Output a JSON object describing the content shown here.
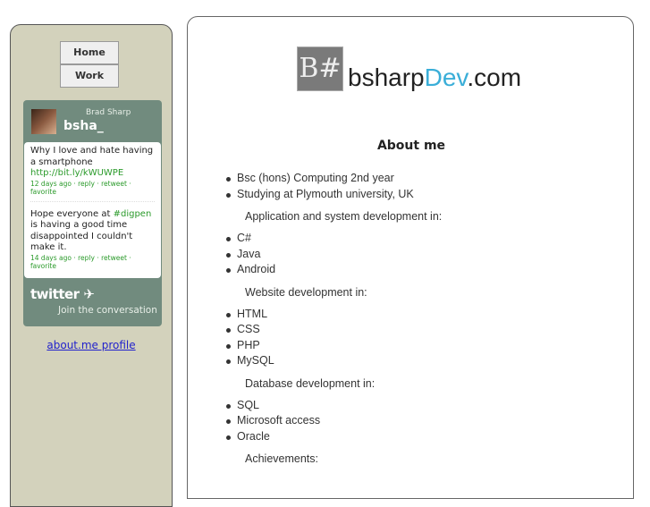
{
  "nav": {
    "home": "Home",
    "work": "Work"
  },
  "twitter": {
    "display_name": "Brad Sharp",
    "username": "bsha_",
    "tweets": [
      {
        "text": "Why I love and hate having a smartphone ",
        "link": "http://bit.ly/kWUWPE",
        "time": "12 days ago",
        "reply": "reply",
        "retweet": "retweet",
        "favorite": "favorite"
      },
      {
        "text_before": "Hope everyone at ",
        "hashtag": "#digpen",
        "text_after": " is having a good time disappointed I couldn't make it.",
        "time": "14 days ago",
        "reply": "reply",
        "retweet": "retweet",
        "favorite": "favorite"
      }
    ],
    "logo": "twitter",
    "join": "Join the conversation"
  },
  "about_link": "about.me profile",
  "logo": {
    "mark": "B#",
    "name_a": "bsharp",
    "name_b": "Dev",
    "name_c": ".com",
    "accent": "#3aaed8"
  },
  "main": {
    "title": "About me",
    "intro": [
      "Bsc (hons) Computing 2nd year",
      "Studying at Plymouth university, UK"
    ],
    "sections": [
      {
        "heading": "Application and system development in:",
        "items": [
          "C#",
          "Java",
          "Android"
        ]
      },
      {
        "heading": "Website development in:",
        "items": [
          "HTML",
          "CSS",
          "PHP",
          "MySQL"
        ]
      },
      {
        "heading": "Database development in:",
        "items": [
          "SQL",
          "Microsoft access",
          "Oracle"
        ]
      },
      {
        "heading": "Achievements:",
        "items": []
      }
    ]
  }
}
